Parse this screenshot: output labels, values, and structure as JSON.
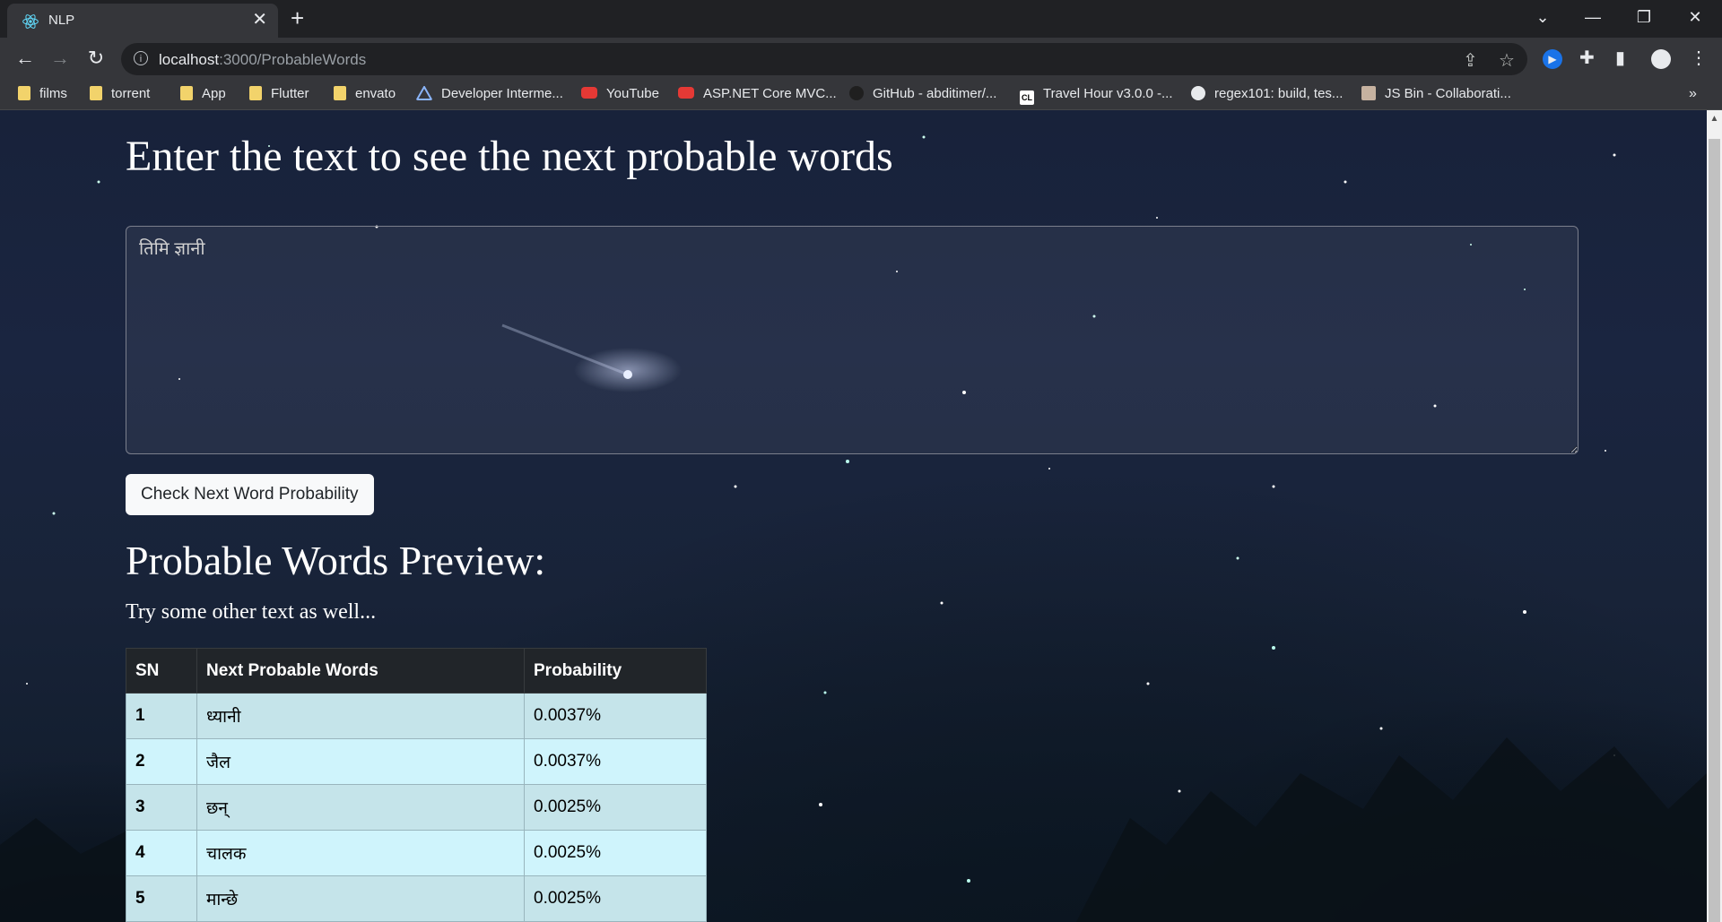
{
  "browser": {
    "tab_title": "NLP",
    "url_host": "localhost",
    "url_path": ":3000/ProbableWords",
    "bookmarks": [
      {
        "label": "films",
        "icon": "folder-icon"
      },
      {
        "label": "torrent",
        "icon": "folder-icon"
      },
      {
        "label": "App",
        "icon": "folder-icon"
      },
      {
        "label": "Flutter",
        "icon": "folder-icon"
      },
      {
        "label": "envato",
        "icon": "folder-icon"
      },
      {
        "label": "Developer Interme...",
        "icon": "developer-icon"
      },
      {
        "label": "YouTube",
        "icon": "youtube-icon"
      },
      {
        "label": "ASP.NET Core MVC...",
        "icon": "youtube-icon"
      },
      {
        "label": "GitHub - abditimer/...",
        "icon": "github-icon"
      },
      {
        "label": "Travel Hour v3.0.0 -...",
        "icon": "codelist-icon"
      },
      {
        "label": "regex101: build, tes...",
        "icon": "regex-icon"
      },
      {
        "label": "JS Bin - Collaborati...",
        "icon": "jsbin-icon"
      }
    ],
    "more_bookmarks": "»"
  },
  "page": {
    "heading": "Enter the text to see the next probable words",
    "input_value": "तिमि ज्ञानी",
    "button_label": "Check Next Word Probability",
    "preview_heading": "Probable Words Preview:",
    "hint": "Try some other text as well...",
    "table": {
      "headers": [
        "SN",
        "Next Probable Words",
        "Probability"
      ],
      "rows": [
        [
          "1",
          "ध्यानी",
          "0.0037%"
        ],
        [
          "2",
          "जैल",
          "0.0037%"
        ],
        [
          "3",
          "छन्",
          "0.0025%"
        ],
        [
          "4",
          "चालक",
          "0.0025%"
        ],
        [
          "5",
          "मान्छे",
          "0.0025%"
        ]
      ]
    }
  },
  "colors": {
    "chrome_dark": "#202124",
    "chrome_toolbar": "#35363a",
    "table_header": "#212529",
    "row_odd": "#c5e4ea",
    "row_even": "#cff4fc"
  }
}
